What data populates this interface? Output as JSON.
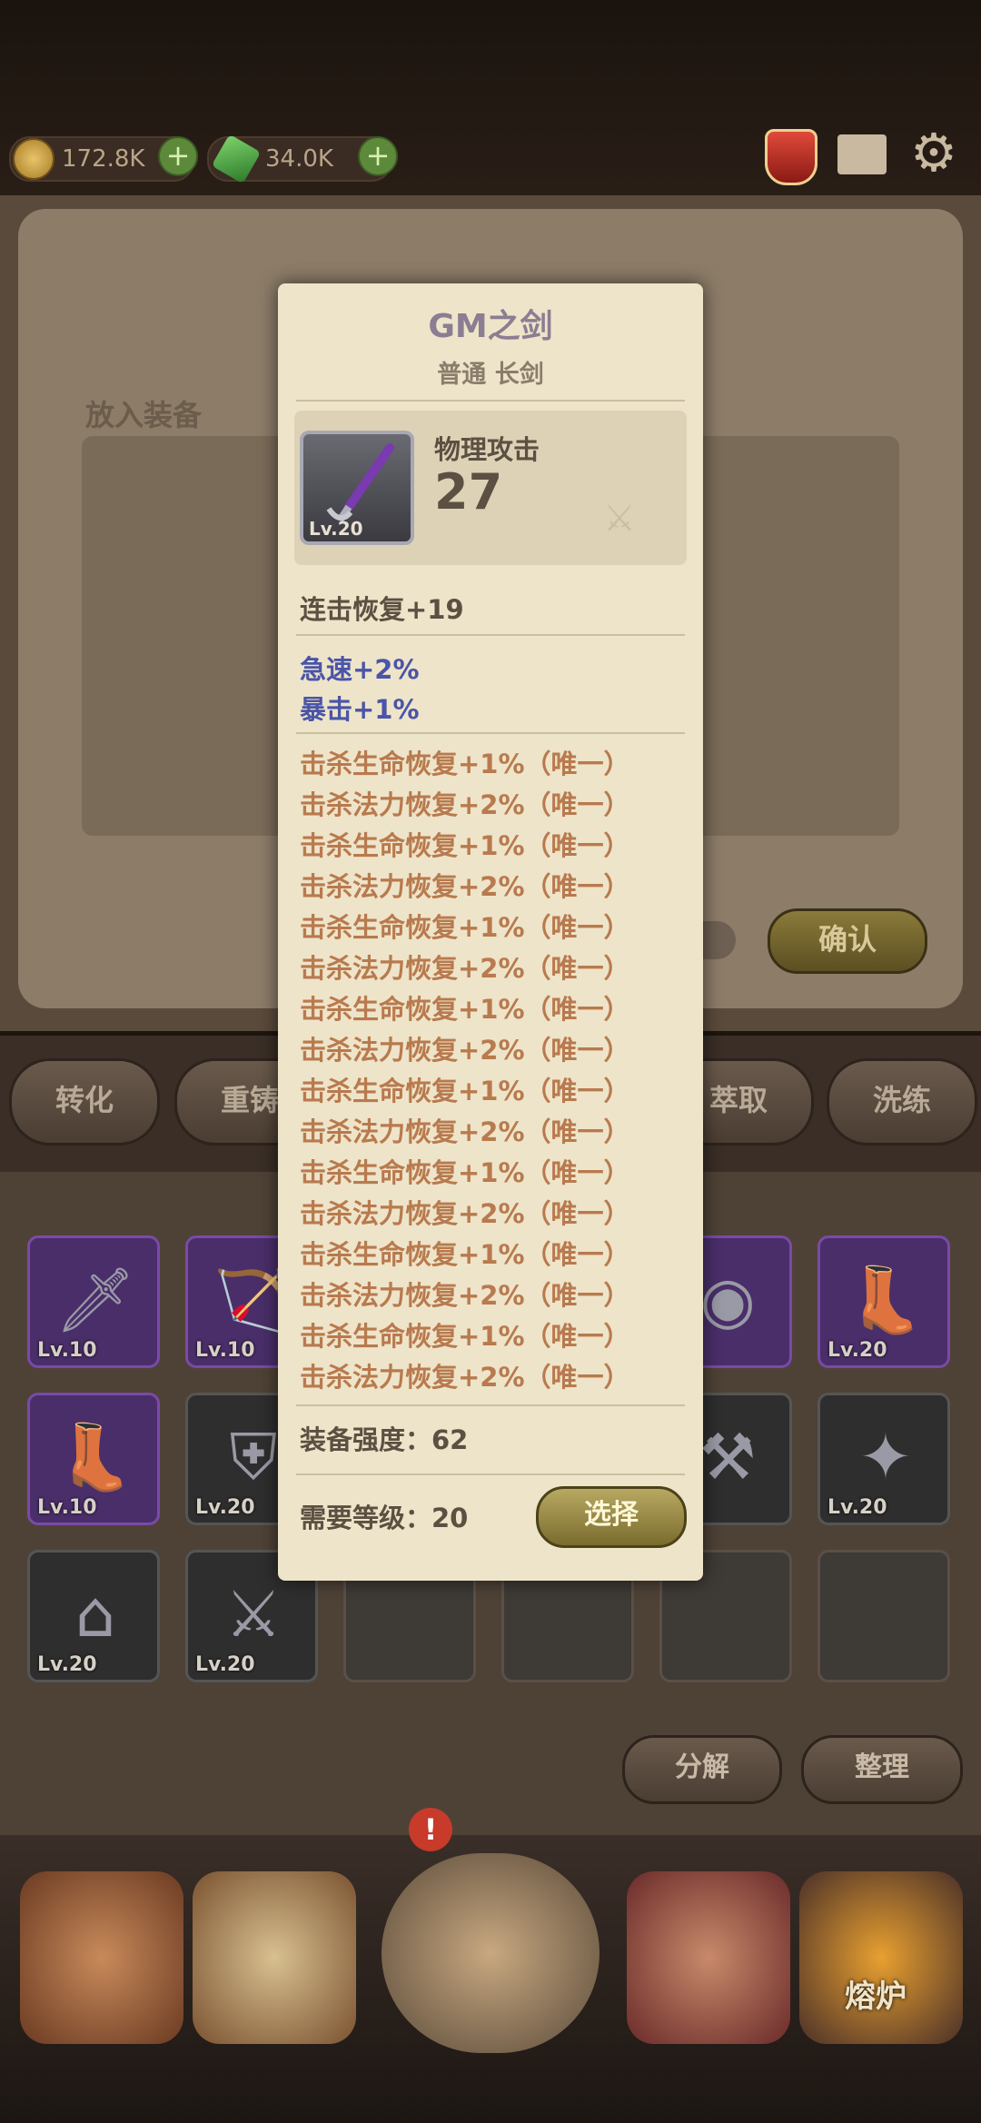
{
  "currency": {
    "gold": "172.8K",
    "gems": "34.0K"
  },
  "header_icons": [
    "potion-icon",
    "mail-icon",
    "gear-icon"
  ],
  "forge": {
    "put_equipment_label": "放入装备",
    "confirm_label": "确认",
    "tabs": [
      "转化",
      "重铸",
      "萃取",
      "洗练"
    ]
  },
  "inventory": {
    "rows": [
      [
        {
          "lv": "Lv.10",
          "icon": "dagger",
          "rarity": "purple"
        },
        {
          "lv": "Lv.10",
          "icon": "bow",
          "rarity": "purple"
        },
        {
          "lv": "",
          "icon": "",
          "rarity": "hidden"
        },
        {
          "lv": "",
          "icon": "",
          "rarity": "hidden"
        },
        {
          "lv": "20",
          "icon": "eye-orb",
          "rarity": "purple"
        },
        {
          "lv": "Lv.20",
          "icon": "boots",
          "rarity": "purple"
        }
      ],
      [
        {
          "lv": "Lv.10",
          "icon": "boots",
          "rarity": "purple"
        },
        {
          "lv": "Lv.20",
          "icon": "shield",
          "rarity": "dark"
        },
        {
          "lv": "",
          "icon": "",
          "rarity": "hidden"
        },
        {
          "lv": "",
          "icon": "",
          "rarity": "hidden"
        },
        {
          "lv": "20",
          "icon": "mace",
          "rarity": "dark"
        },
        {
          "lv": "Lv.20",
          "icon": "emblem",
          "rarity": "dark"
        }
      ],
      [
        {
          "lv": "Lv.20",
          "icon": "hood",
          "rarity": "dark"
        },
        {
          "lv": "Lv.20",
          "icon": "sword",
          "rarity": "dark"
        },
        {
          "lv": "",
          "icon": "",
          "rarity": "empty"
        },
        {
          "lv": "",
          "icon": "",
          "rarity": "empty"
        },
        {
          "lv": "",
          "icon": "",
          "rarity": "empty"
        },
        {
          "lv": "",
          "icon": "",
          "rarity": "empty"
        }
      ]
    ],
    "decompose_label": "分解",
    "sort_label": "整理"
  },
  "nav": {
    "items": [
      "home",
      "tavern",
      "battle",
      "treasure",
      "熔炉"
    ],
    "active": "熔炉",
    "alert": "!"
  },
  "popup": {
    "title": "GM之剑",
    "subtitle": "普通 长剑",
    "item_level": "Lv.20",
    "main_stat_label": "物理攻击",
    "main_stat_value": "27",
    "base_line": "连击恢复+19",
    "blue_lines": [
      "急速+2%",
      "暴击+1%"
    ],
    "orange_lines": [
      "击杀生命恢复+1%（唯一）",
      "击杀法力恢复+2%（唯一）",
      "击杀生命恢复+1%（唯一）",
      "击杀法力恢复+2%（唯一）",
      "击杀生命恢复+1%（唯一）",
      "击杀法力恢复+2%（唯一）",
      "击杀生命恢复+1%（唯一）",
      "击杀法力恢复+2%（唯一）",
      "击杀生命恢复+1%（唯一）",
      "击杀法力恢复+2%（唯一）",
      "击杀生命恢复+1%（唯一）",
      "击杀法力恢复+2%（唯一）",
      "击杀生命恢复+1%（唯一）",
      "击杀法力恢复+2%（唯一）",
      "击杀生命恢复+1%（唯一）",
      "击杀法力恢复+2%（唯一）"
    ],
    "strength": "装备强度：62",
    "required_level": "需要等级：20",
    "select_label": "选择"
  }
}
